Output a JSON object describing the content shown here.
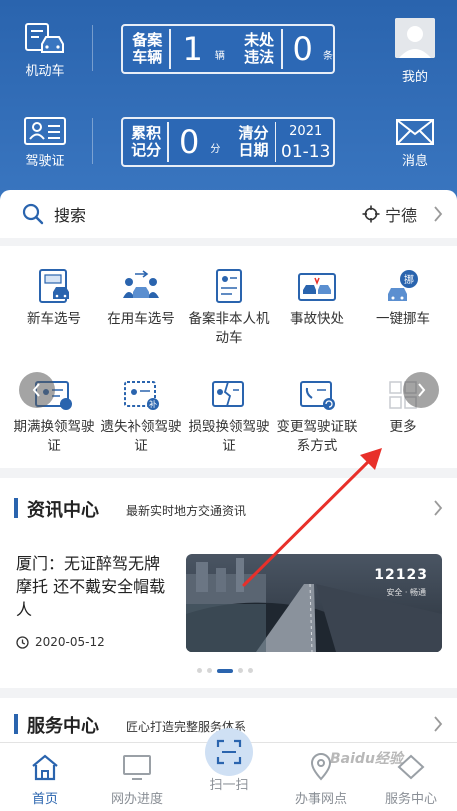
{
  "header": {
    "vehicle_label": "机动车",
    "license_label": "驾驶证",
    "mine_label": "我的",
    "messages_label": "消息",
    "board1": {
      "left_label": "备案车辆",
      "left_value": "1",
      "left_unit": "辆",
      "right_label": "未处违法",
      "right_value": "0",
      "right_unit": "条"
    },
    "board2": {
      "left_label": "累积记分",
      "left_value": "0",
      "left_unit": "分",
      "right_label": "清分日期",
      "date_year": "2021",
      "date_md": "01-13"
    }
  },
  "search": {
    "label": "搜索",
    "city": "宁德"
  },
  "services": [
    {
      "label": "新车选号",
      "icon": "new-car-icon"
    },
    {
      "label": "在用车选号",
      "icon": "used-car-icon"
    },
    {
      "label": "备案非本人机动车",
      "icon": "register-icon"
    },
    {
      "label": "事故快处",
      "icon": "accident-icon"
    },
    {
      "label": "一键挪车",
      "icon": "move-car-icon"
    },
    {
      "label": "期满换领驾驶证",
      "icon": "renew-license-icon"
    },
    {
      "label": "遗失补领驾驶证",
      "icon": "lost-license-icon"
    },
    {
      "label": "损毁换领驾驶证",
      "icon": "damaged-license-icon"
    },
    {
      "label": "变更驾驶证联系方式",
      "icon": "change-contact-icon"
    },
    {
      "label": "更多",
      "icon": "more-icon"
    }
  ],
  "news": {
    "title": "资讯中心",
    "subtitle": "最新实时地方交通资讯",
    "headline": "厦门：无证醉驾无牌摩托 还不戴安全帽载人",
    "date": "2020-05-12",
    "image_caption": "12123",
    "image_sub": "安全 · 畅通"
  },
  "service_center": {
    "title": "服务中心",
    "subtitle": "匠心打造完整服务体系"
  },
  "bottom_nav": [
    {
      "label": "首页",
      "active": true
    },
    {
      "label": "网办进度",
      "active": false
    },
    {
      "label": "扫一扫",
      "active": false
    },
    {
      "label": "办事网点",
      "active": false
    },
    {
      "label": "服务中心",
      "active": false
    }
  ],
  "watermark": "Baidu经验",
  "colors": {
    "primary": "#2a64ae",
    "header_bg": "#3a76c0",
    "annotation_arrow": "#e8302a"
  }
}
